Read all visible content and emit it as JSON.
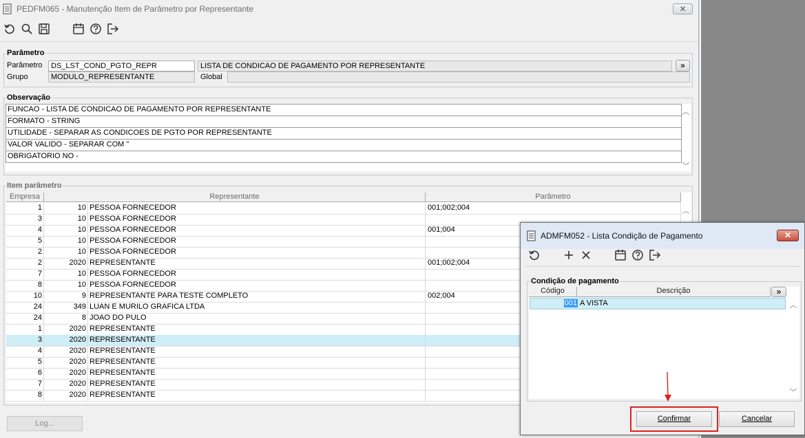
{
  "main": {
    "title": "PEDFM065 - Manutenção Item de Parâmetro por Representante",
    "close_glyph": "✕",
    "toolbar": [
      "refresh-icon",
      "search-icon",
      "save-icon",
      "calendar-icon",
      "help-icon",
      "exit-icon"
    ],
    "parametro_group": {
      "title": "Parâmetro",
      "parametro_label": "Parâmetro",
      "parametro_value": "DS_LST_COND_PGTO_REPR",
      "parametro_desc": "LISTA DE CONDICAO DE PAGAMENTO POR REPRESENTANTE",
      "expand_label": "»",
      "grupo_label": "Grupo",
      "grupo_value": "MODULO_REPRESENTANTE",
      "global_label": "Global",
      "global_value": ""
    },
    "observacao": {
      "title": "Observação",
      "lines": [
        "FUNCAO - LISTA DE CONDICAO DE PAGAMENTO POR REPRESENTANTE",
        "FORMATO - STRING",
        "UTILIDADE - SEPARAR AS CONDICOES DE PGTO POR REPRESENTANTE",
        "VALOR VALIDO - SEPARAR COM \"",
        "OBRIGATORIO NO -"
      ]
    },
    "items": {
      "title": "Item parâmetro",
      "columns": [
        "Empresa",
        "Representante",
        "Parâmetro"
      ],
      "rows": [
        {
          "empresa": "1",
          "codigo": "10",
          "nome": "PESSOA FORNECEDOR",
          "parametro": "001;002;004"
        },
        {
          "empresa": "3",
          "codigo": "10",
          "nome": "PESSOA FORNECEDOR",
          "parametro": ""
        },
        {
          "empresa": "4",
          "codigo": "10",
          "nome": "PESSOA FORNECEDOR",
          "parametro": "001;004"
        },
        {
          "empresa": "5",
          "codigo": "10",
          "nome": "PESSOA FORNECEDOR",
          "parametro": ""
        },
        {
          "empresa": "2",
          "codigo": "10",
          "nome": "PESSOA FORNECEDOR",
          "parametro": ""
        },
        {
          "empresa": "2",
          "codigo": "2020",
          "nome": "REPRESENTANTE",
          "parametro": "001;002;004"
        },
        {
          "empresa": "7",
          "codigo": "10",
          "nome": "PESSOA FORNECEDOR",
          "parametro": ""
        },
        {
          "empresa": "8",
          "codigo": "10",
          "nome": "PESSOA FORNECEDOR",
          "parametro": ""
        },
        {
          "empresa": "10",
          "codigo": "9",
          "nome": "REPRESENTANTE PARA TESTE COMPLETO",
          "parametro": "002;004"
        },
        {
          "empresa": "24",
          "codigo": "349",
          "nome": "LUAN E MURILO GRAFICA LTDA",
          "parametro": ""
        },
        {
          "empresa": "24",
          "codigo": "8",
          "nome": "JOAO DO PULO",
          "parametro": ""
        },
        {
          "empresa": "1",
          "codigo": "2020",
          "nome": "REPRESENTANTE",
          "parametro": ""
        },
        {
          "empresa": "3",
          "codigo": "2020",
          "nome": "REPRESENTANTE",
          "parametro": ""
        },
        {
          "empresa": "4",
          "codigo": "2020",
          "nome": "REPRESENTANTE",
          "parametro": ""
        },
        {
          "empresa": "5",
          "codigo": "2020",
          "nome": "REPRESENTANTE",
          "parametro": ""
        },
        {
          "empresa": "6",
          "codigo": "2020",
          "nome": "REPRESENTANTE",
          "parametro": ""
        },
        {
          "empresa": "7",
          "codigo": "2020",
          "nome": "REPRESENTANTE",
          "parametro": ""
        },
        {
          "empresa": "8",
          "codigo": "2020",
          "nome": "REPRESENTANTE",
          "parametro": ""
        }
      ],
      "selected_row": 12
    },
    "log_button": "Log..."
  },
  "popup": {
    "title": "ADMFM052 - Lista Condição de Pagamento",
    "close_glyph": "✕",
    "toolbar": [
      "refresh-icon",
      "add-icon",
      "delete-icon",
      "calendar-icon",
      "help-icon",
      "exit-icon"
    ],
    "group_title": "Condição de pagamento",
    "columns": [
      "Código",
      "Descrição"
    ],
    "expand_label": "»",
    "rows": [
      {
        "codigo": "001",
        "descricao": "A VISTA"
      }
    ],
    "confirm_button": "Confirmar",
    "cancel_button": "Cancelar"
  },
  "colors": {
    "selected_row": "#d0eef7",
    "highlight_annotation": "#e02020"
  }
}
